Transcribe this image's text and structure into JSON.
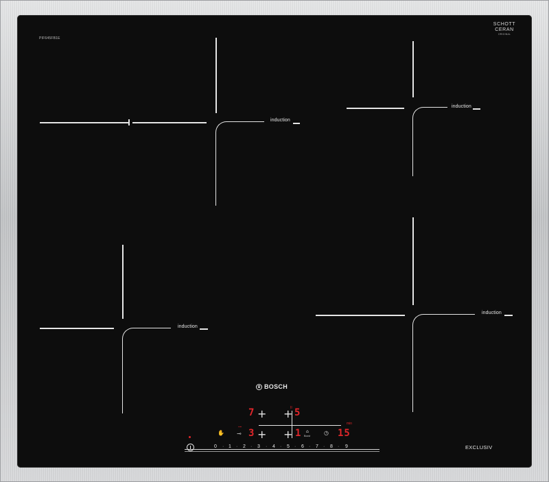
{
  "hob": {
    "model_code": "PIF645FB1E",
    "glass_brand": {
      "line1": "SCHOTT",
      "line2": "CERAN",
      "sub": "ORIGINAL"
    },
    "brand": "BOSCH",
    "series_badge": "EXCLUSIV",
    "zone_label": "induction"
  },
  "controls": {
    "power_icon": "power-icon",
    "slider_digits": [
      "0",
      "1",
      "2",
      "3",
      "4",
      "5",
      "6",
      "7",
      "8",
      "9"
    ],
    "left_top_display": "7",
    "left_bottom_display": "3",
    "right_top_display": "5",
    "right_top_small": "II",
    "right_bottom_display": "1",
    "timer_display": "15",
    "timer_unit": "min",
    "lock_icon": "childlock-icon",
    "wipe_icon": "wipe-protection-icon",
    "boost_icon": "boost-icon",
    "boost_label": "Boost",
    "timer_icon": "timer-icon",
    "key_icon": "key-icon",
    "colors": {
      "indicator": "#e0262a",
      "line": "#e6e6e6",
      "glass": "#0d0d0d",
      "steel": "#c8c9cb"
    }
  }
}
